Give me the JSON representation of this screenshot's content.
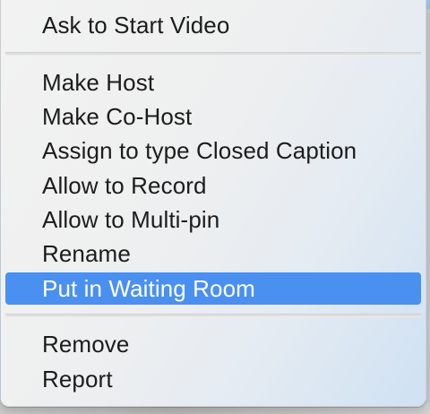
{
  "context_menu": {
    "groups": [
      {
        "items": [
          {
            "label": "Ask to Start Video"
          }
        ]
      },
      {
        "items": [
          {
            "label": "Make Host"
          },
          {
            "label": "Make Co-Host"
          },
          {
            "label": "Assign to type Closed Caption"
          },
          {
            "label": "Allow to Record"
          },
          {
            "label": "Allow to Multi-pin"
          },
          {
            "label": "Rename"
          },
          {
            "label": "Put in Waiting Room",
            "selected": true
          }
        ]
      },
      {
        "items": [
          {
            "label": "Remove"
          },
          {
            "label": "Report"
          }
        ]
      }
    ],
    "highlight_color": "#4a90f0"
  }
}
